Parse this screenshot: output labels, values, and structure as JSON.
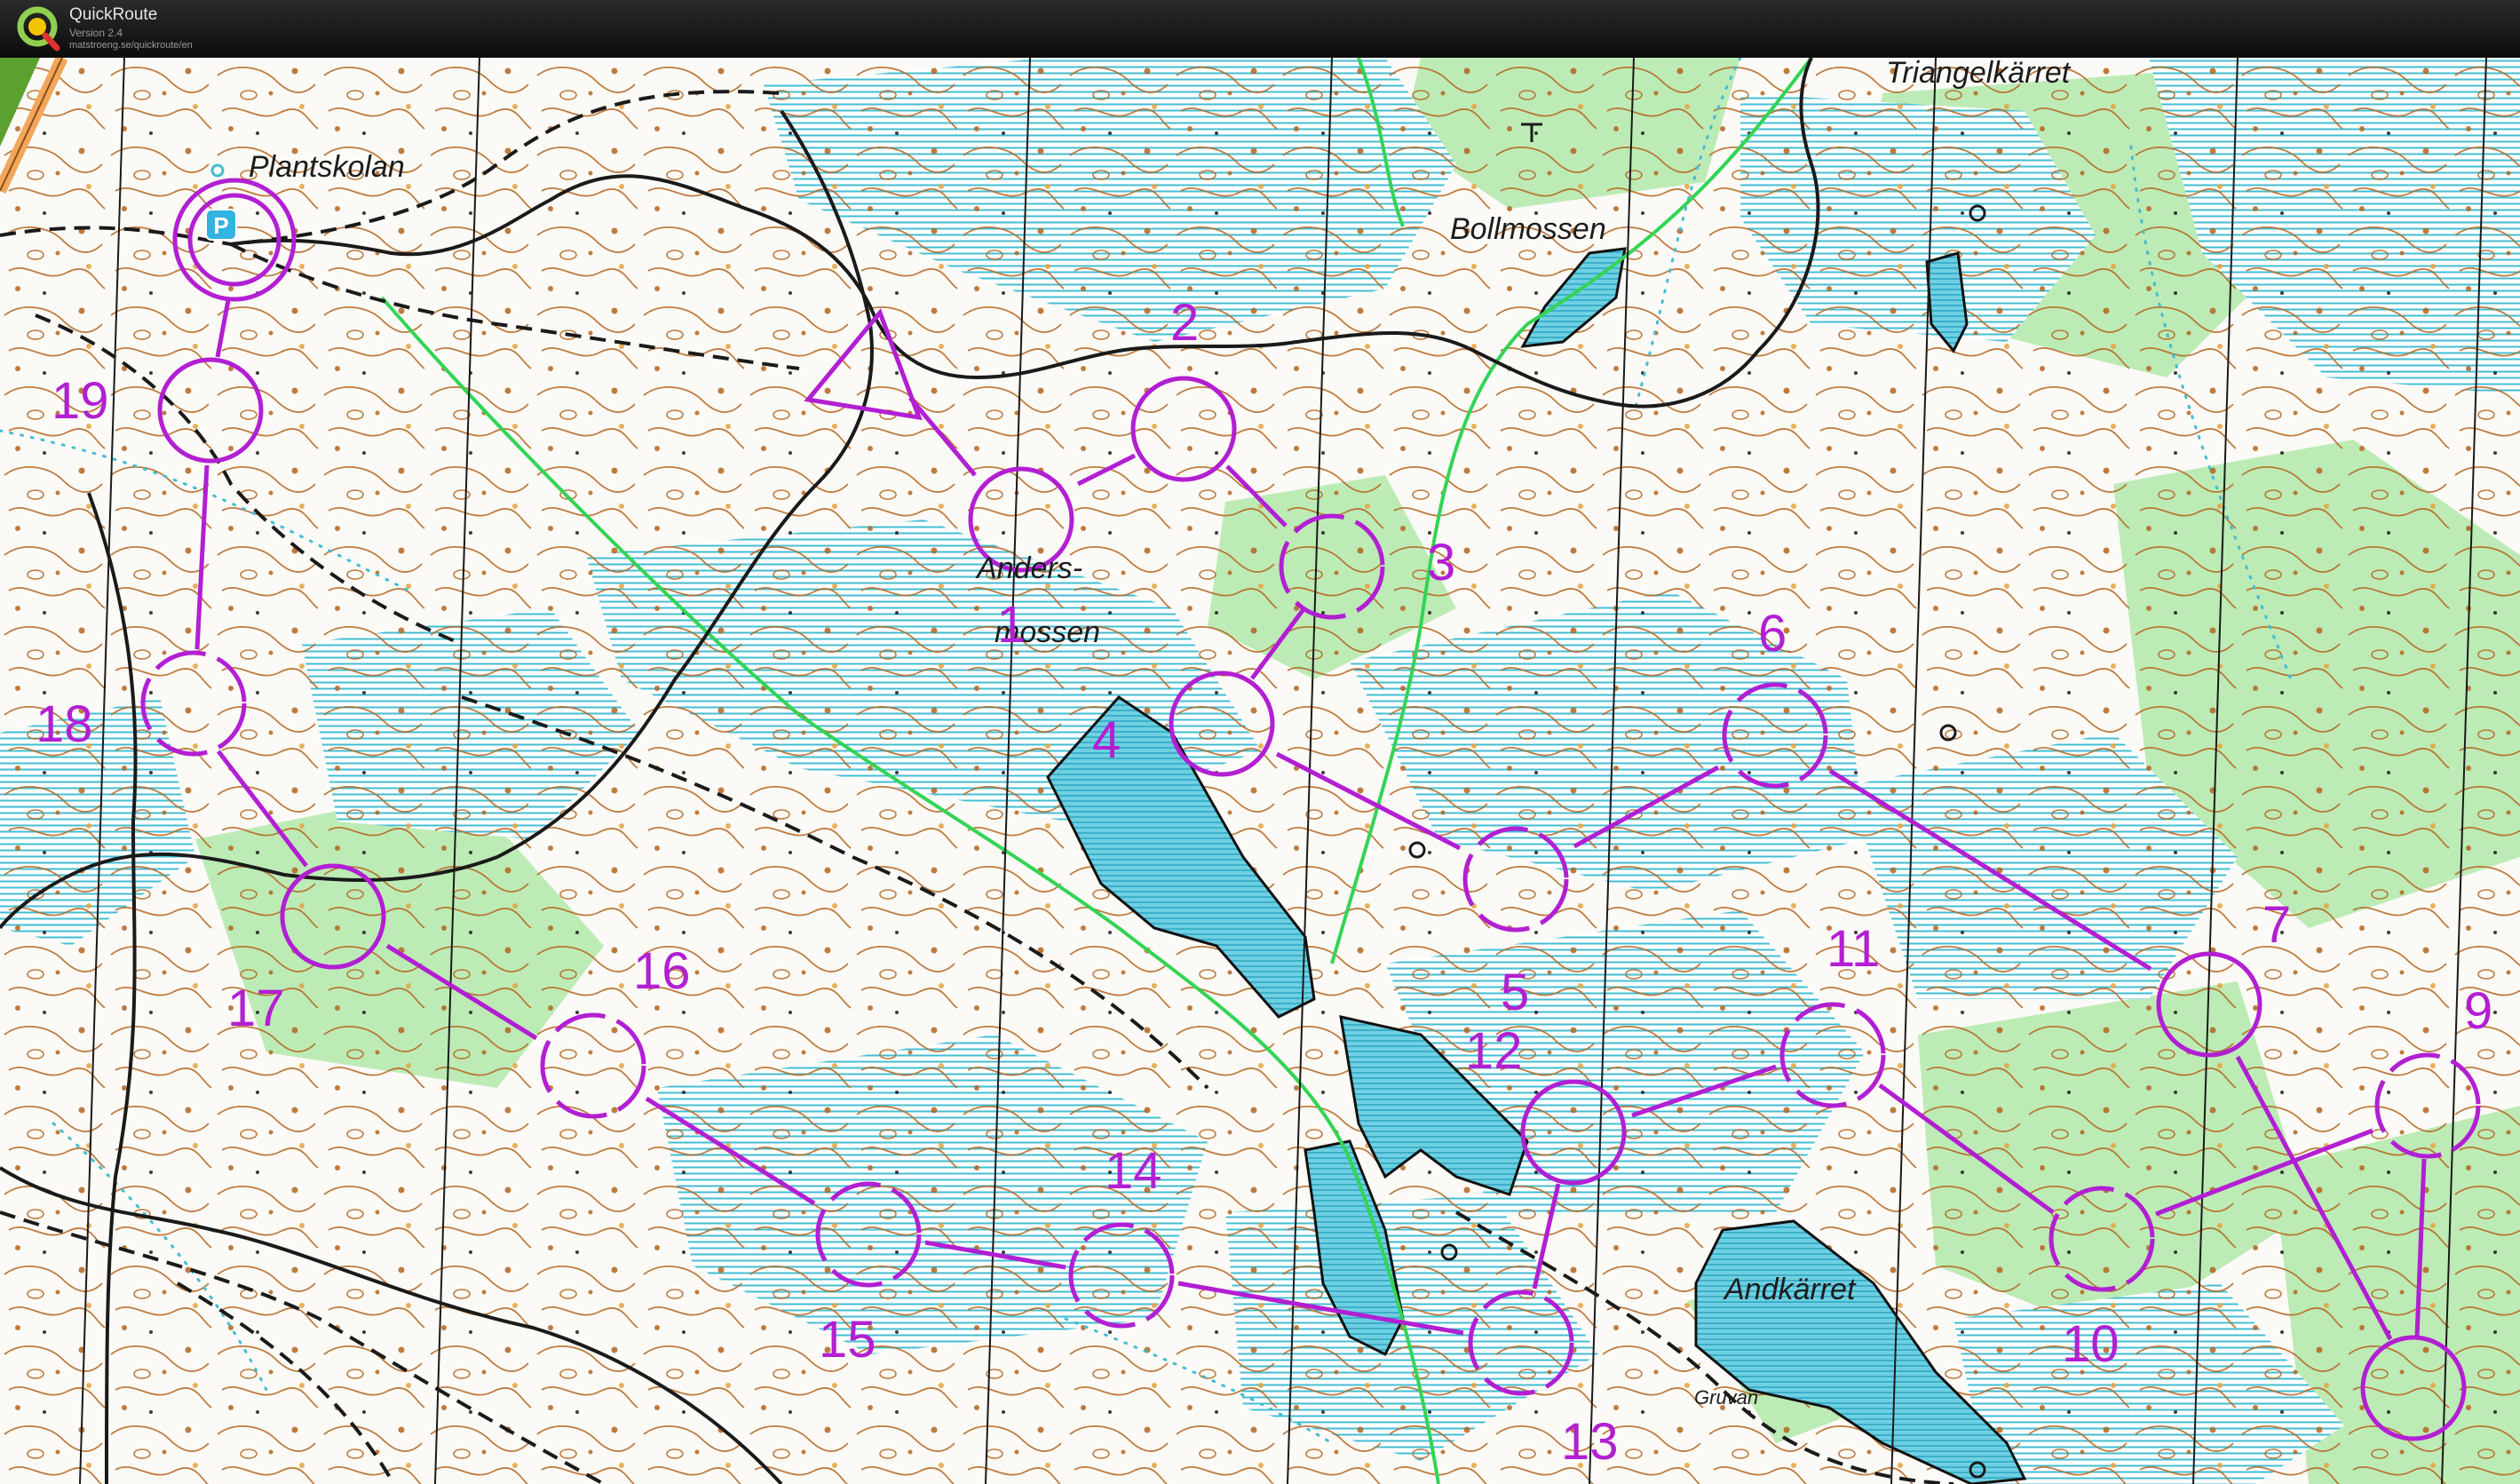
{
  "app": {
    "name": "QuickRoute",
    "version": "Version 2.4",
    "url": "matstroeng.se/quickroute/en"
  },
  "map": {
    "place_names": {
      "triangelkarret": "Triangelkärret",
      "plantskolan": "Plantskolan",
      "bollmossen": "Bollmossen",
      "andersmossen_1": "Anders-",
      "andersmossen_2": "mossen",
      "andkarret": "Andkärret",
      "gruvan": "Gruvan"
    },
    "parking_symbol": "P",
    "course": {
      "color": "#b21fd3",
      "control_numbers": [
        "1",
        "2",
        "3",
        "4",
        "5",
        "6",
        "7",
        "9",
        "10",
        "11",
        "12",
        "13",
        "14",
        "15",
        "16",
        "17",
        "18",
        "19"
      ]
    },
    "colors": {
      "contour": "#b4651f",
      "water": "#43bdd2",
      "open_green": "#a8e6a0",
      "track": "#1a1a1a",
      "course": "#b21fd3"
    }
  }
}
